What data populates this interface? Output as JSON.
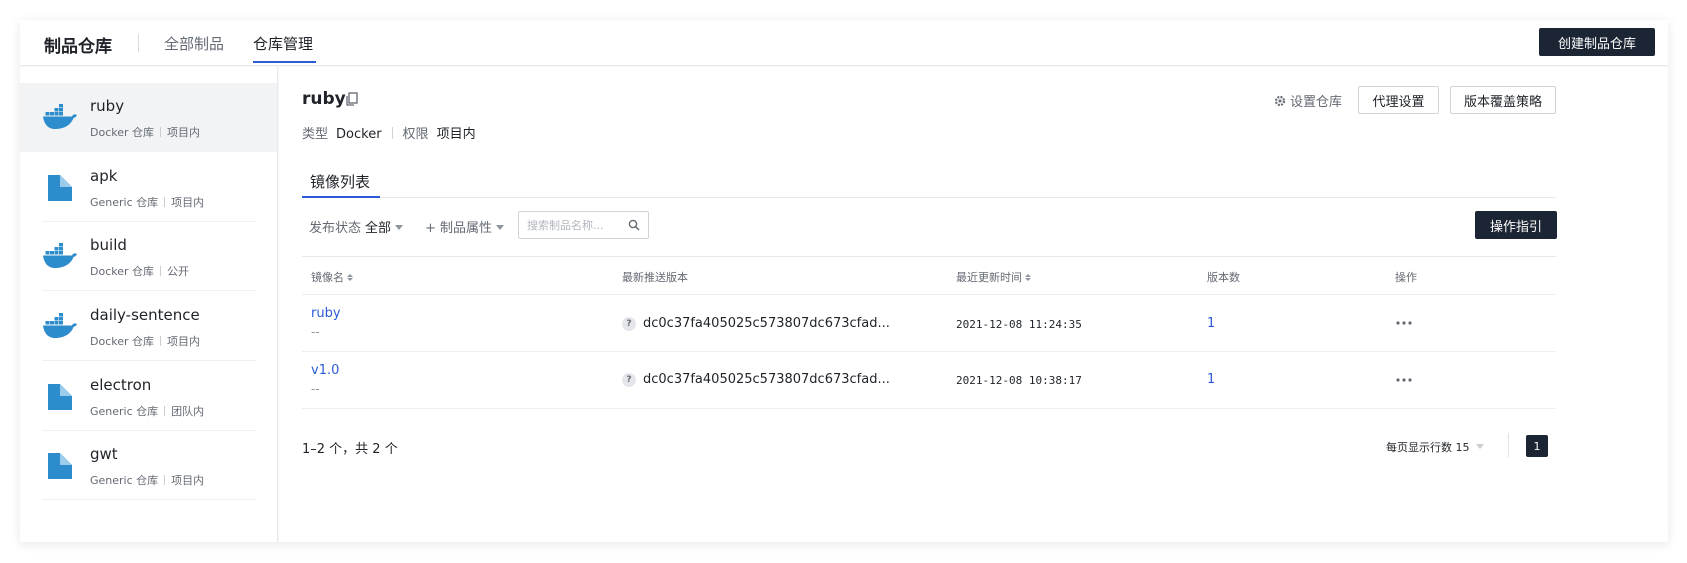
{
  "header": {
    "brand": "制品仓库",
    "tabs": [
      {
        "label": "全部制品"
      },
      {
        "label": "仓库管理"
      }
    ],
    "create_button": "创建制品仓库"
  },
  "sidebar": {
    "items": [
      {
        "name": "ruby",
        "type": "Docker 仓库",
        "scope": "项目内",
        "icon": "docker-whale-icon"
      },
      {
        "name": "apk",
        "type": "Generic 仓库",
        "scope": "项目内",
        "icon": "generic-file-icon"
      },
      {
        "name": "build",
        "type": "Docker 仓库",
        "scope": "公开",
        "icon": "docker-whale-icon"
      },
      {
        "name": "daily-sentence",
        "type": "Docker 仓库",
        "scope": "项目内",
        "icon": "docker-whale-icon"
      },
      {
        "name": "electron",
        "type": "Generic 仓库",
        "scope": "团队内",
        "icon": "generic-file-icon"
      },
      {
        "name": "gwt",
        "type": "Generic 仓库",
        "scope": "项目内",
        "icon": "generic-file-icon"
      }
    ]
  },
  "repo": {
    "title": "ruby",
    "type_label": "类型",
    "type_value": "Docker",
    "perm_label": "权限",
    "perm_value": "项目内",
    "settings_link": "设置仓库",
    "proxy_button": "代理设置",
    "policy_button": "版本覆盖策略"
  },
  "subtab": {
    "label": "镜像列表"
  },
  "filters": {
    "status_label": "发布状态",
    "status_value": "全部",
    "attr_label": "+ 制品属性",
    "search_placeholder": "搜索制品名称...",
    "guide_button": "操作指引"
  },
  "table": {
    "headers": {
      "name": "镜像名",
      "latest": "最新推送版本",
      "updated": "最近更新时间",
      "versions": "版本数",
      "actions": "操作"
    },
    "rows": [
      {
        "name": "ruby",
        "desc": "--",
        "hash": "dc0c37fa405025c573807dc673cfad...",
        "time": "2021-12-08 11:24:35",
        "versions": "1"
      },
      {
        "name": "v1.0",
        "desc": "--",
        "hash": "dc0c37fa405025c573807dc673cfad...",
        "time": "2021-12-08 10:38:17",
        "versions": "1"
      }
    ]
  },
  "pagination": {
    "summary": "1–2 个，共 2 个",
    "page_size_label": "每页显示行数",
    "page_size_value": "15",
    "current_page": "1"
  },
  "colors": {
    "accent": "#2b5bd7",
    "dark_button": "#1c2533",
    "docker_blue": "#2d8ccb"
  }
}
